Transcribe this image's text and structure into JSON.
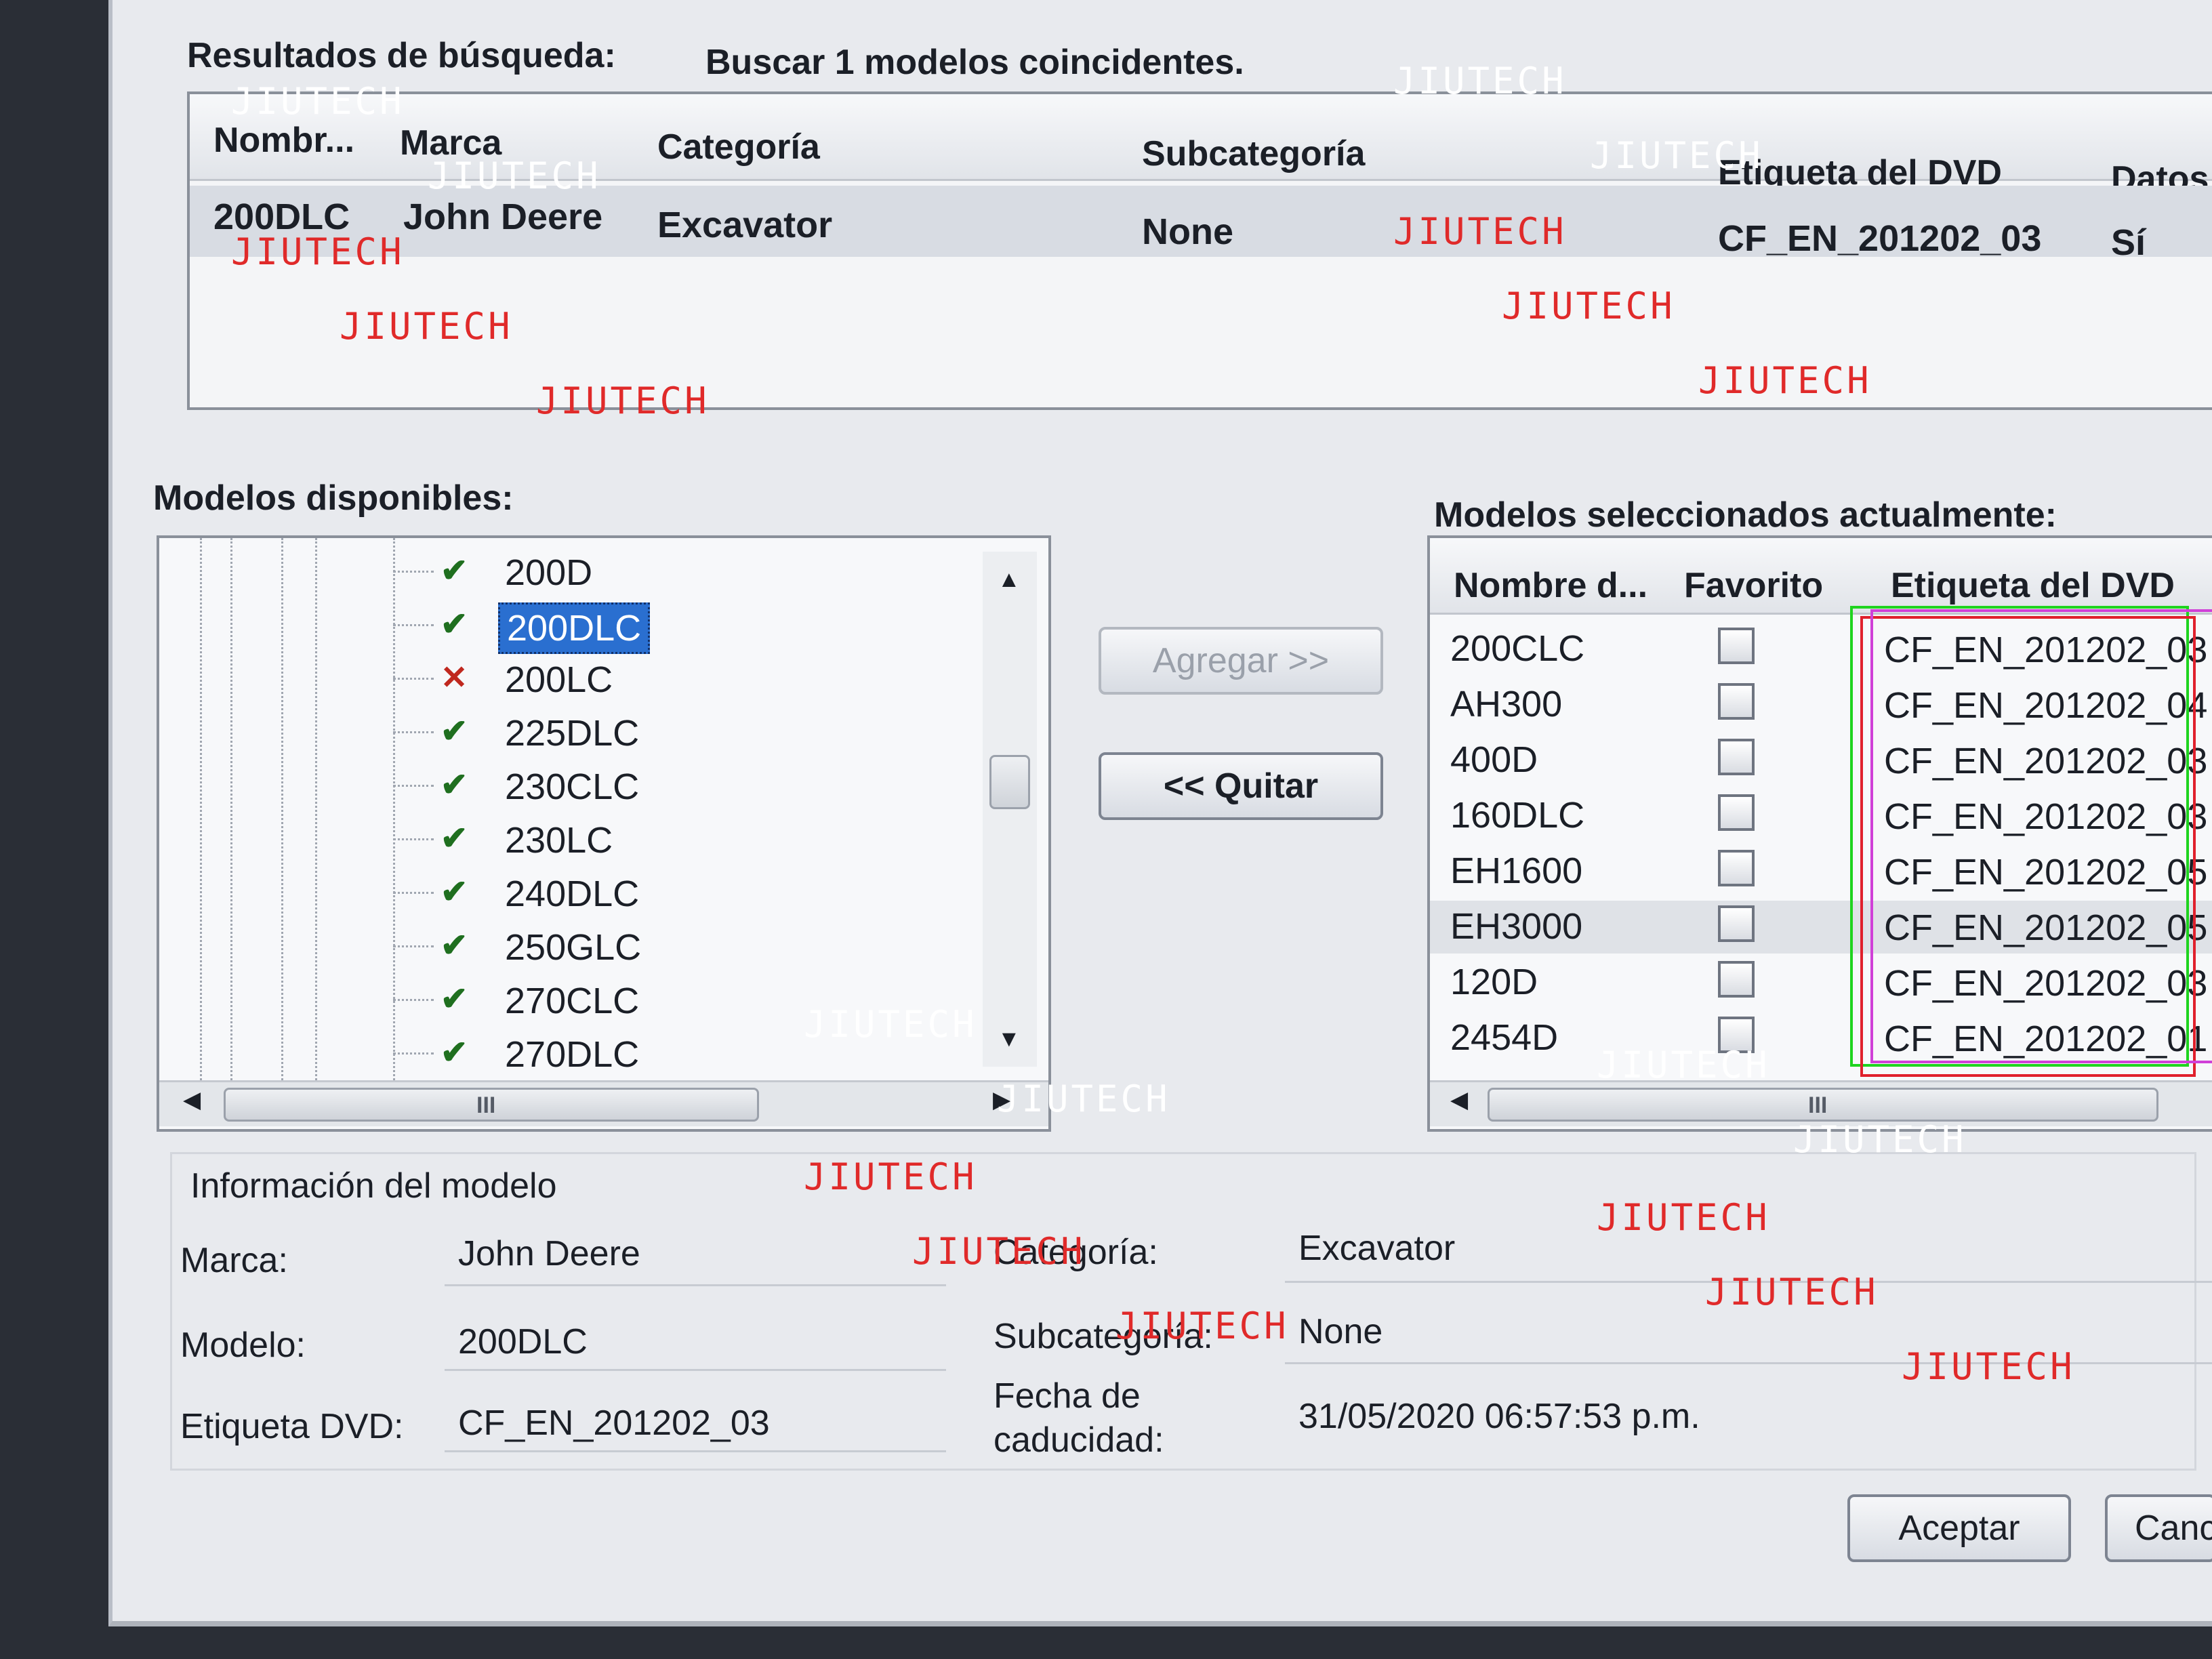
{
  "search": {
    "label": "Resultados de búsqueda:",
    "summary": "Buscar 1 modelos coincidentes.",
    "columns": [
      "Nombr...",
      "Marca",
      "Categoría",
      "Subcategoría",
      "Etiqueta del DVD",
      "Datos"
    ],
    "row": [
      "200DLC",
      "John Deere",
      "Excavator",
      "None",
      "CF_EN_201202_03",
      "Sí"
    ]
  },
  "available": {
    "label": "Modelos disponibles:",
    "items": [
      {
        "name": "200D",
        "status": "ok"
      },
      {
        "name": "200DLC",
        "status": "ok",
        "selected": true
      },
      {
        "name": "200LC",
        "status": "error"
      },
      {
        "name": "225DLC",
        "status": "ok"
      },
      {
        "name": "230CLC",
        "status": "ok"
      },
      {
        "name": "230LC",
        "status": "ok"
      },
      {
        "name": "240DLC",
        "status": "ok"
      },
      {
        "name": "250GLC",
        "status": "ok"
      },
      {
        "name": "270CLC",
        "status": "ok"
      },
      {
        "name": "270DLC",
        "status": "ok"
      }
    ],
    "scroll_grip": "III"
  },
  "buttons": {
    "add": "Agregar >>",
    "remove": "<< Quitar",
    "accept": "Aceptar",
    "cancel": "Canc"
  },
  "selected": {
    "label": "Modelos seleccionados actualmente:",
    "columns": [
      "Nombre d...",
      "Favorito",
      "Etiqueta del DVD"
    ],
    "rows": [
      {
        "name": "200CLC",
        "dvd": "CF_EN_201202_03"
      },
      {
        "name": "AH300",
        "dvd": "CF_EN_201202_04"
      },
      {
        "name": "400D",
        "dvd": "CF_EN_201202_03"
      },
      {
        "name": "160DLC",
        "dvd": "CF_EN_201202_03"
      },
      {
        "name": "EH1600",
        "dvd": "CF_EN_201202_05"
      },
      {
        "name": "EH3000",
        "dvd": "CF_EN_201202_05"
      },
      {
        "name": "120D",
        "dvd": "CF_EN_201202_03"
      },
      {
        "name": "2454D",
        "dvd": "CF_EN_201202_01"
      }
    ],
    "scroll_grip": "III"
  },
  "info": {
    "title": "Información del modelo",
    "brand_label": "Marca:",
    "brand": "John Deere",
    "model_label": "Modelo:",
    "model": "200DLC",
    "dvd_label": "Etiqueta DVD:",
    "dvd": "CF_EN_201202_03",
    "category_label": "Categoría:",
    "category": "Excavator",
    "subcategory_label": "Subcategoría:",
    "subcategory": "None",
    "expiry_label_1": "Fecha de",
    "expiry_label_2": "caducidad:",
    "expiry": "31/05/2020 06:57:53 p.m."
  },
  "watermark": "JIUTECH",
  "colors": {
    "check": "#1f6f1f",
    "cross": "#c0281e",
    "selection": "#2a6fd0",
    "annot_green": "#1fd41f",
    "annot_red": "#e0202c",
    "annot_magenta": "#d040d8"
  }
}
